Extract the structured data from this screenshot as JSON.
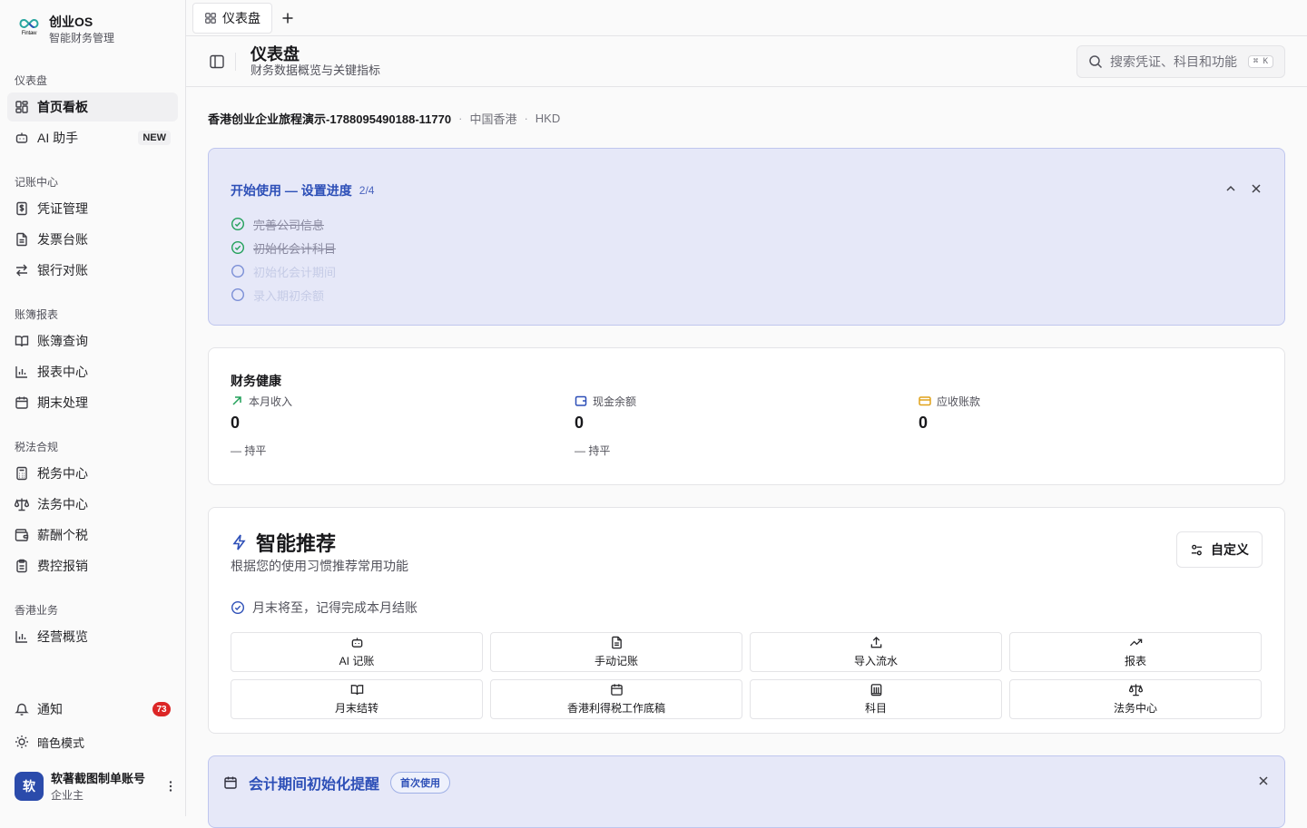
{
  "brand": {
    "name": "创业OS",
    "subtitle": "智能财务管理",
    "logo_caption": "Fintaw"
  },
  "sidebar": {
    "groups": [
      {
        "title": "仪表盘",
        "items": [
          {
            "label": "首页看板",
            "icon": "dashboard-grid-icon",
            "active": true
          },
          {
            "label": "AI 助手",
            "icon": "bot-icon",
            "badge": "NEW"
          }
        ]
      },
      {
        "title": "记账中心",
        "items": [
          {
            "label": "凭证管理",
            "icon": "receipt-dollar-icon"
          },
          {
            "label": "发票台账",
            "icon": "file-text-icon"
          },
          {
            "label": "银行对账",
            "icon": "arrows-swap-icon"
          }
        ]
      },
      {
        "title": "账簿报表",
        "items": [
          {
            "label": "账簿查询",
            "icon": "book-open-icon"
          },
          {
            "label": "报表中心",
            "icon": "bar-chart-icon"
          },
          {
            "label": "期末处理",
            "icon": "calendar-icon"
          }
        ]
      },
      {
        "title": "税法合规",
        "items": [
          {
            "label": "税务中心",
            "icon": "calculator-icon"
          },
          {
            "label": "法务中心",
            "icon": "scale-icon"
          },
          {
            "label": "薪酬个税",
            "icon": "wallet-icon"
          },
          {
            "label": "费控报销",
            "icon": "clipboard-icon"
          }
        ]
      },
      {
        "title": "香港业务",
        "items": [
          {
            "label": "经营概览",
            "icon": "bar-chart-icon"
          }
        ]
      }
    ],
    "notifications": {
      "label": "通知",
      "count": "73"
    },
    "dark_mode": {
      "label": "暗色模式"
    },
    "user": {
      "avatar": "软",
      "name": "软著截图制单账号",
      "role": "企业主"
    }
  },
  "tabs": [
    {
      "label": "仪表盘"
    }
  ],
  "header": {
    "title": "仪表盘",
    "subtitle": "财务数据概览与关键指标",
    "search_placeholder": "搜索凭证、科目和功能",
    "search_shortcut": "⌘ K"
  },
  "company": {
    "name": "香港创业企业旅程演示-1788095490188-11770",
    "region": "中国香港",
    "currency": "HKD"
  },
  "setup": {
    "title": "开始使用 — 设置进度",
    "progress": "2/4",
    "steps": [
      {
        "label": "完善公司信息",
        "done": true
      },
      {
        "label": "初始化会计科目",
        "done": true
      },
      {
        "label": "初始化会计期间",
        "done": false
      },
      {
        "label": "录入期初余额",
        "done": false
      }
    ]
  },
  "health": {
    "title": "财务健康",
    "metrics": [
      {
        "label": "本月收入",
        "value": "0",
        "trend": "— 持平",
        "icon": "trend-up-arrow-icon",
        "color": "#22a05a"
      },
      {
        "label": "现金余额",
        "value": "0",
        "trend": "— 持平",
        "icon": "wallet-icon",
        "color": "#2d4fb7"
      },
      {
        "label": "应收账款",
        "value": "0",
        "trend": "",
        "icon": "credit-card-icon",
        "color": "#e0a21a"
      }
    ]
  },
  "recommend": {
    "title": "智能推荐",
    "subtitle": "根据您的使用习惯推荐常用功能",
    "customize_label": "自定义",
    "reminder": "月末将至，记得完成本月结账",
    "tiles": [
      {
        "label": "AI 记账",
        "icon": "bot-icon"
      },
      {
        "label": "手动记账",
        "icon": "file-text-icon"
      },
      {
        "label": "导入流水",
        "icon": "upload-icon"
      },
      {
        "label": "报表",
        "icon": "trend-up-icon"
      },
      {
        "label": "月末结转",
        "icon": "book-open-icon"
      },
      {
        "label": "香港利得税工作底稿",
        "icon": "calendar-icon"
      },
      {
        "label": "科目",
        "icon": "library-icon"
      },
      {
        "label": "法务中心",
        "icon": "scale-icon"
      }
    ]
  },
  "init_notice": {
    "title": "会计期间初始化提醒",
    "tag": "首次使用"
  }
}
